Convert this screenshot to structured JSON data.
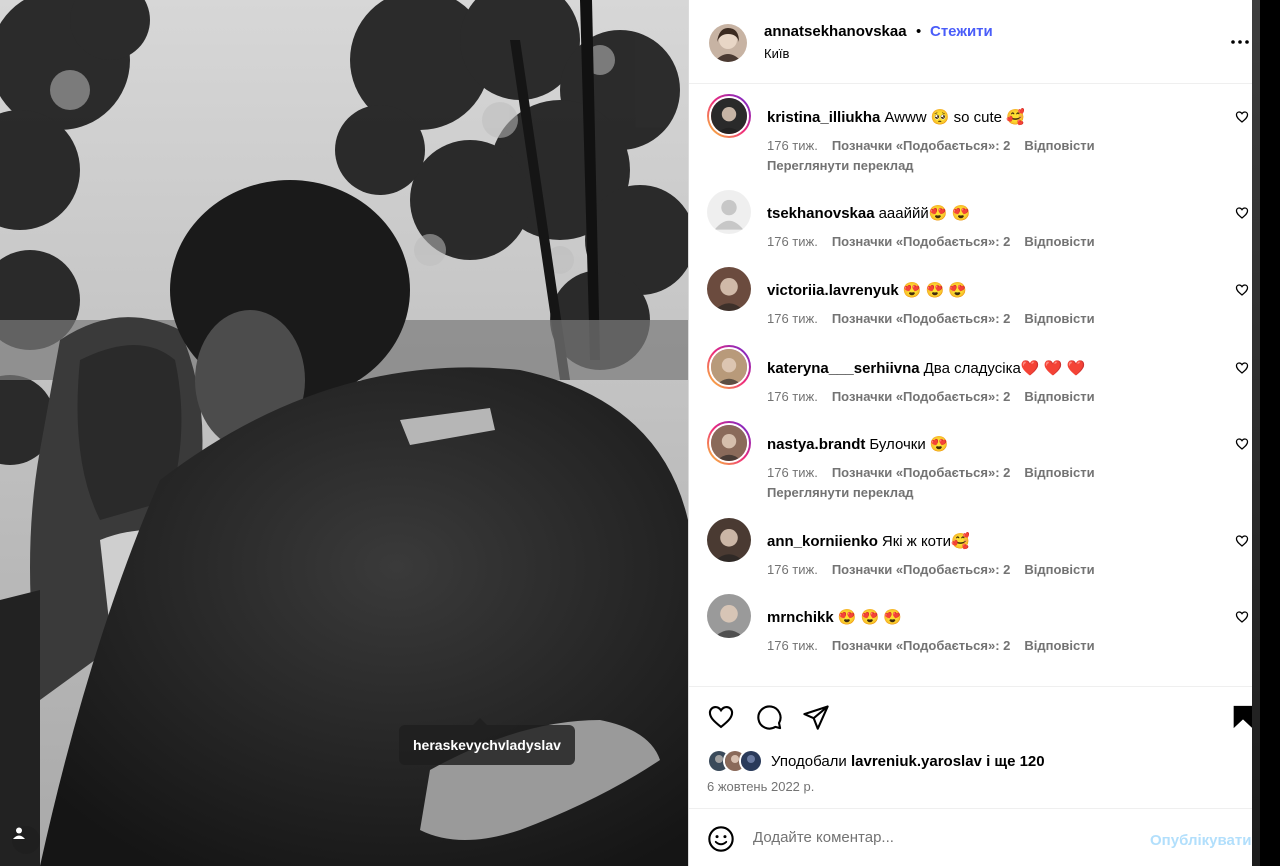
{
  "post": {
    "photo_tag": "heraskevychvladyslav",
    "author": "annatsekhanovskaa",
    "separator": "•",
    "follow_label": "Стежити",
    "location": "Київ"
  },
  "comments": [
    {
      "user": "kristina_illiukha",
      "text": "Awww 🥺 so cute 🥰",
      "time": "176 тиж.",
      "likes": "Позначки «Подобається»: 2",
      "reply": "Відповісти",
      "translate": "Переглянути переклад",
      "ring": true,
      "avatar_color": "#2a2a2a"
    },
    {
      "user": "tsekhanovskaa",
      "text": "аааййй😍 😍",
      "time": "176 тиж.",
      "likes": "Позначки «Подобається»: 2",
      "reply": "Відповісти",
      "translate": null,
      "ring": false,
      "avatar_color": "#dbdbdb"
    },
    {
      "user": "victoriia.lavrenyuk",
      "text": "😍 😍 😍",
      "time": "176 тиж.",
      "likes": "Позначки «Подобається»: 2",
      "reply": "Відповісти",
      "translate": null,
      "ring": false,
      "avatar_color": "#6b4b3e"
    },
    {
      "user": "kateryna___serhiivna",
      "text": "Два сладусіка❤️ ❤️ ❤️",
      "time": "176 тиж.",
      "likes": "Позначки «Подобається»: 2",
      "reply": "Відповісти",
      "translate": null,
      "ring": true,
      "avatar_color": "#b89a7a"
    },
    {
      "user": "nastya.brandt",
      "text": "Булочки 😍",
      "time": "176 тиж.",
      "likes": "Позначки «Подобається»: 2",
      "reply": "Відповісти",
      "translate": "Переглянути переклад",
      "ring": true,
      "avatar_color": "#8a6a5a"
    },
    {
      "user": "ann_korniienko",
      "text": "Які ж коти🥰",
      "time": "176 тиж.",
      "likes": "Позначки «Подобається»: 2",
      "reply": "Відповісти",
      "translate": null,
      "ring": false,
      "avatar_color": "#4a3a32"
    },
    {
      "user": "mrnchikk",
      "text": "😍 😍 😍",
      "time": "176 тиж.",
      "likes": "Позначки «Подобається»: 2",
      "reply": "Відповісти",
      "translate": null,
      "ring": false,
      "avatar_color": "#9a9a9a"
    }
  ],
  "actions": {
    "liked_by_prefix": "Уподобали",
    "liked_by_user": "lavreniuk.yaroslav",
    "liked_by_suffix": "і ще 120",
    "date": "6 жовтень 2022 р."
  },
  "comment_box": {
    "placeholder": "Додайте коментар...",
    "publish_label": "Опублікувати"
  },
  "icons": {
    "more": "more-icon",
    "like": "heart-icon",
    "comment": "comment-icon",
    "share": "share-icon",
    "save": "bookmark-icon",
    "emoji": "emoji-icon",
    "user_tag": "user-icon"
  },
  "colors": {
    "follow": "#4a5df9",
    "muted": "#737373",
    "publish_disabled": "#b2dffc"
  }
}
